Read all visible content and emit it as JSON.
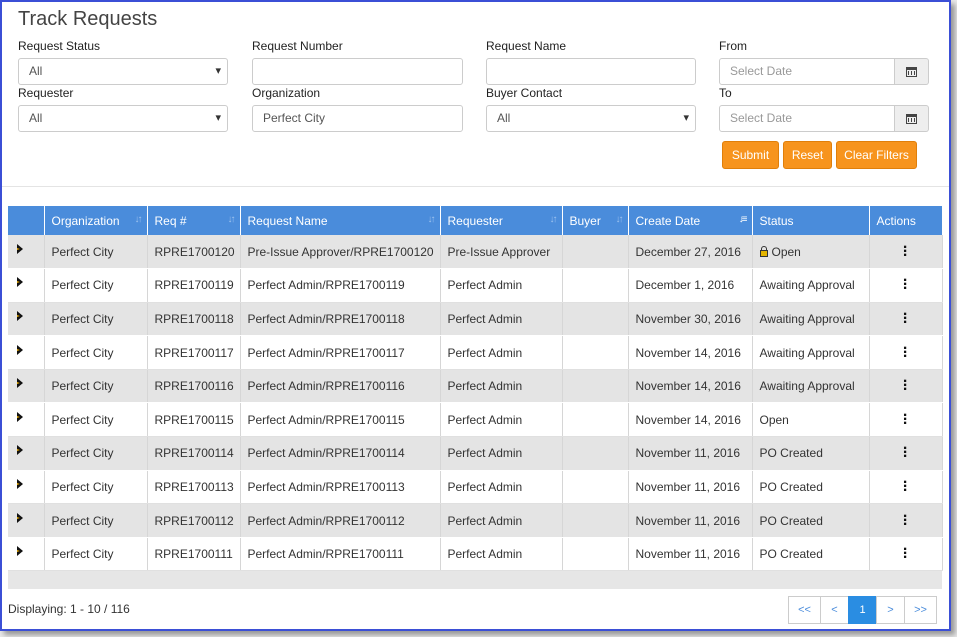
{
  "page": {
    "title": "Track Requests"
  },
  "filters": {
    "request_status": {
      "label": "Request Status",
      "value": "All"
    },
    "request_number": {
      "label": "Request Number",
      "value": ""
    },
    "request_name": {
      "label": "Request Name",
      "value": ""
    },
    "from": {
      "label": "From",
      "placeholder": "Select Date"
    },
    "requester": {
      "label": "Requester",
      "value": "All"
    },
    "organization": {
      "label": "Organization",
      "value": "Perfect City"
    },
    "buyer_contact": {
      "label": "Buyer Contact",
      "value": "All"
    },
    "to": {
      "label": "To",
      "placeholder": "Select Date"
    }
  },
  "buttons": {
    "submit": "Submit",
    "reset": "Reset",
    "clear_filters": "Clear Filters"
  },
  "table": {
    "columns": [
      "Organization",
      "Req #",
      "Request Name",
      "Requester",
      "Buyer",
      "Create Date",
      "Status",
      "Actions"
    ],
    "rows": [
      {
        "org": "Perfect City",
        "req": "RPRE1700120",
        "name": "Pre-Issue Approver/RPRE1700120",
        "requester": "Pre-Issue Approver",
        "buyer": "",
        "date": "December 27, 2016",
        "status": "Open",
        "locked": true
      },
      {
        "org": "Perfect City",
        "req": "RPRE1700119",
        "name": "Perfect Admin/RPRE1700119",
        "requester": "Perfect Admin",
        "buyer": "",
        "date": "December 1, 2016",
        "status": "Awaiting Approval"
      },
      {
        "org": "Perfect City",
        "req": "RPRE1700118",
        "name": "Perfect Admin/RPRE1700118",
        "requester": "Perfect Admin",
        "buyer": "",
        "date": "November 30, 2016",
        "status": "Awaiting Approval"
      },
      {
        "org": "Perfect City",
        "req": "RPRE1700117",
        "name": "Perfect Admin/RPRE1700117",
        "requester": "Perfect Admin",
        "buyer": "",
        "date": "November 14, 2016",
        "status": "Awaiting Approval"
      },
      {
        "org": "Perfect City",
        "req": "RPRE1700116",
        "name": "Perfect Admin/RPRE1700116",
        "requester": "Perfect Admin",
        "buyer": "",
        "date": "November 14, 2016",
        "status": "Awaiting Approval"
      },
      {
        "org": "Perfect City",
        "req": "RPRE1700115",
        "name": "Perfect Admin/RPRE1700115",
        "requester": "Perfect Admin",
        "buyer": "",
        "date": "November 14, 2016",
        "status": "Open"
      },
      {
        "org": "Perfect City",
        "req": "RPRE1700114",
        "name": "Perfect Admin/RPRE1700114",
        "requester": "Perfect Admin",
        "buyer": "",
        "date": "November 11, 2016",
        "status": "PO Created"
      },
      {
        "org": "Perfect City",
        "req": "RPRE1700113",
        "name": "Perfect Admin/RPRE1700113",
        "requester": "Perfect Admin",
        "buyer": "",
        "date": "November 11, 2016",
        "status": "PO Created"
      },
      {
        "org": "Perfect City",
        "req": "RPRE1700112",
        "name": "Perfect Admin/RPRE1700112",
        "requester": "Perfect Admin",
        "buyer": "",
        "date": "November 11, 2016",
        "status": "PO Created"
      },
      {
        "org": "Perfect City",
        "req": "RPRE1700111",
        "name": "Perfect Admin/RPRE1700111",
        "requester": "Perfect Admin",
        "buyer": "",
        "date": "November 11, 2016",
        "status": "PO Created"
      }
    ]
  },
  "footer": {
    "displaying": "Displaying: 1 - 10 / 116"
  },
  "pager": {
    "first": "<<",
    "prev": "<",
    "current": "1",
    "next": ">",
    "last": ">>"
  },
  "colors": {
    "accent": "#f7941d",
    "header": "#4a8cdb",
    "frame": "#3b4fd6"
  }
}
